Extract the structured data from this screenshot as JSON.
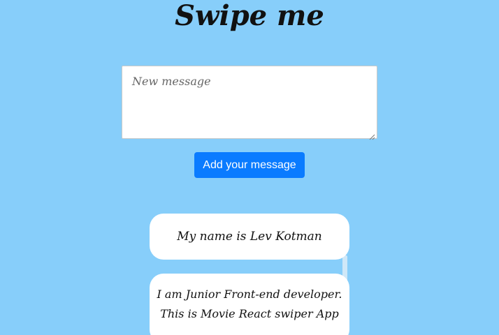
{
  "title": "Swipe me",
  "message_input": {
    "placeholder": "New message",
    "value": ""
  },
  "add_button": {
    "label": "Add your message"
  },
  "cards": [
    {
      "lines": [
        "My name is Lev Kotman"
      ]
    },
    {
      "lines": [
        "I am Junior Front-end developer.",
        "This is Movie React swiper App"
      ]
    }
  ],
  "icons": {
    "textarea_resize": "resize-grip-icon"
  },
  "colors": {
    "background": "#87CEFA",
    "button": "#0A7BFF",
    "card": "#FFFFFF"
  }
}
